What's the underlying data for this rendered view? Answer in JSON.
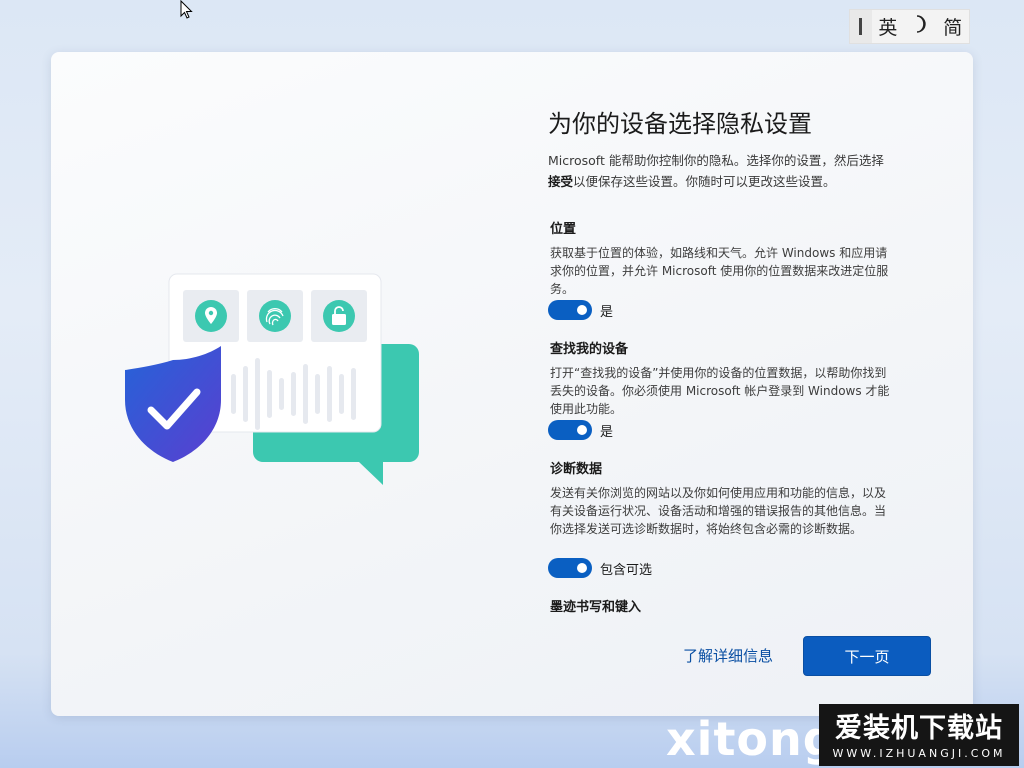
{
  "ime": {
    "items": [
      "英",
      "简"
    ]
  },
  "page": {
    "title": "为你的设备选择隐私设置",
    "intro_part1": "Microsoft 能帮助你控制你的隐私。选择你的设置，然后选择",
    "intro_bold": "接受",
    "intro_part2": "以便保存这些设置。你随时可以更改这些设置。"
  },
  "sections": [
    {
      "title": "位置",
      "desc": "获取基于位置的体验，如路线和天气。允许 Windows 和应用请求你的位置，并允许 Microsoft 使用你的位置数据来改进定位服务。",
      "toggle_label": "是",
      "toggle_on": true
    },
    {
      "title": "查找我的设备",
      "desc": "打开“查找我的设备”并使用你的设备的位置数据，以帮助你找到丢失的设备。你必须使用 Microsoft 帐户登录到 Windows 才能使用此功能。",
      "toggle_label": "是",
      "toggle_on": true
    },
    {
      "title": "诊断数据",
      "desc": "发送有关你浏览的网站以及你如何使用应用和功能的信息，以及有关设备运行状况、设备活动和增强的错误报告的其他信息。当你选择发送可选诊断数据时，将始终包含必需的诊断数据。",
      "toggle_label": "包含可选",
      "toggle_on": true
    },
    {
      "title": "墨迹书写和键入"
    }
  ],
  "actions": {
    "learn_more": "了解详细信息",
    "next": "下一页"
  },
  "watermark": {
    "xitong": "xitong",
    "site_name": "爱装机下载站",
    "site_url": "WWW.IZHUANGJI.COM"
  },
  "colors": {
    "accent": "#0b5cbf",
    "teal": "#3cc8b0",
    "shield": "#3a4fd6"
  }
}
